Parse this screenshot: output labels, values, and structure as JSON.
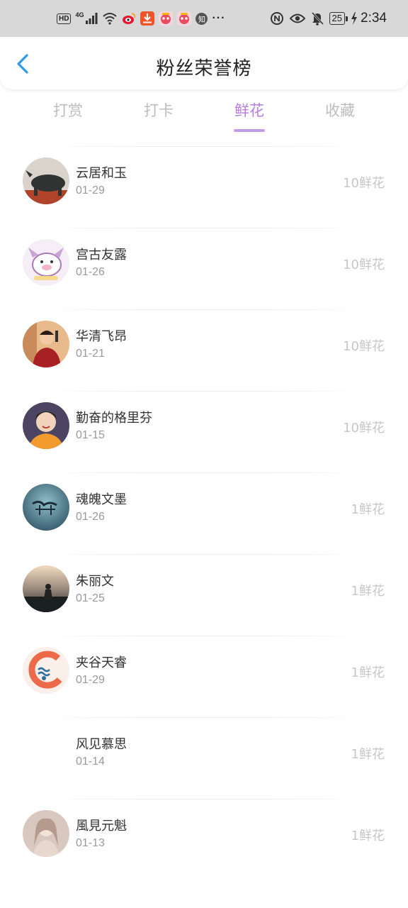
{
  "status_bar": {
    "left_icons": [
      "hd-icon",
      "signal-4g-icon",
      "wifi-icon",
      "weibo-icon",
      "download-icon",
      "app-icon",
      "app-icon",
      "zhihu-icon",
      "more-icon"
    ],
    "hd": "HD",
    "net": "4G",
    "zhihu": "知",
    "more": "···",
    "battery": "25",
    "time": "2:34"
  },
  "header": {
    "title": "粉丝荣誉榜"
  },
  "tabs": [
    {
      "label": "打赏",
      "active": false
    },
    {
      "label": "打卡",
      "active": false
    },
    {
      "label": "鲜花",
      "active": true
    },
    {
      "label": "收藏",
      "active": false
    }
  ],
  "fans": [
    {
      "name": "云居和玉",
      "date": "01-29",
      "count": "10鲜花",
      "avatar": "rhino-statue"
    },
    {
      "name": "宫古友露",
      "date": "01-26",
      "count": "10鲜花",
      "avatar": "purple-pig-cartoon"
    },
    {
      "name": "华清飞昂",
      "date": "01-21",
      "count": "10鲜花",
      "avatar": "man-red-shirt"
    },
    {
      "name": "勤奋的格里芬",
      "date": "01-15",
      "count": "10鲜花",
      "avatar": "smiling-boy"
    },
    {
      "name": "魂魄文墨",
      "date": "01-26",
      "count": "1鲜花",
      "avatar": "teal-calligraphy"
    },
    {
      "name": "朱丽文",
      "date": "01-25",
      "count": "1鲜花",
      "avatar": "sunset-silhouette"
    },
    {
      "name": "夹谷天睿",
      "date": "01-29",
      "count": "1鲜花",
      "avatar": "orange-wave-logo"
    },
    {
      "name": "风见慕思",
      "date": "01-14",
      "count": "1鲜花",
      "avatar": "none"
    },
    {
      "name": "風見元魁",
      "date": "01-13",
      "count": "1鲜花",
      "avatar": "anime-girl"
    }
  ],
  "colors": {
    "accent": "#b57fe0",
    "back_arrow": "#2c9bef",
    "muted": "#c6c6c6"
  }
}
